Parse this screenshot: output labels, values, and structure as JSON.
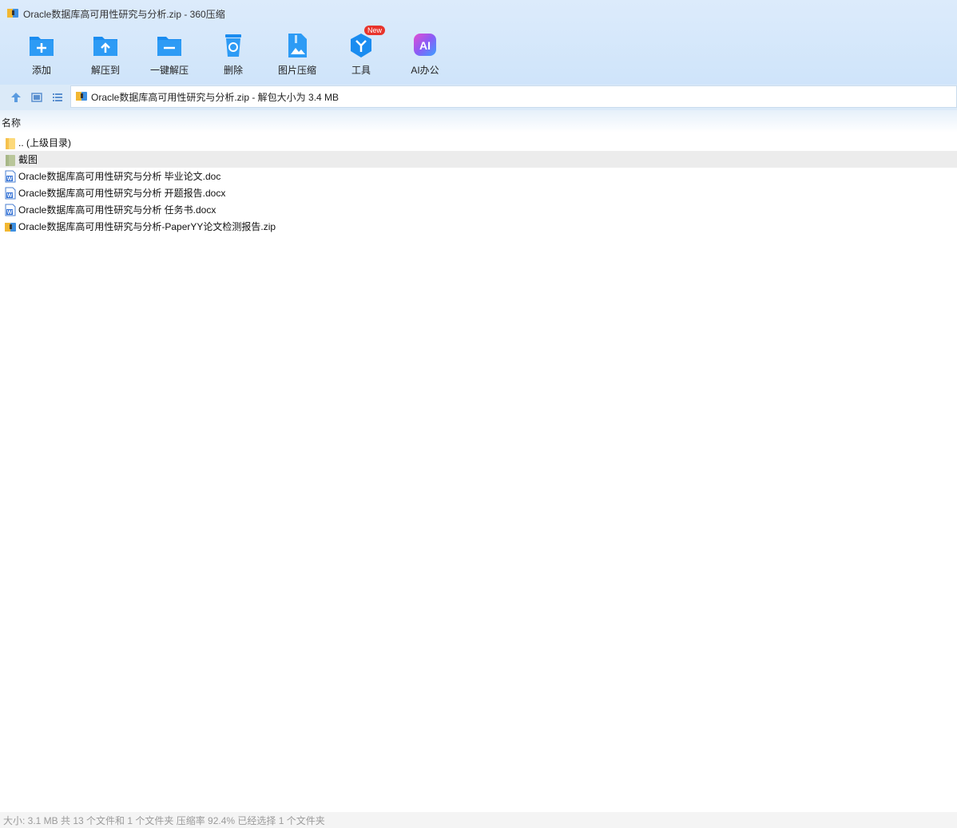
{
  "window": {
    "title": "Oracle数据库高可用性研究与分析.zip - 360压缩"
  },
  "toolbar": {
    "items": [
      {
        "label": "添加",
        "icon": "add-folder-icon"
      },
      {
        "label": "解压到",
        "icon": "extract-to-icon"
      },
      {
        "label": "一键解压",
        "icon": "one-click-extract-icon"
      },
      {
        "label": "删除",
        "icon": "delete-icon"
      },
      {
        "label": "图片压缩",
        "icon": "image-compress-icon"
      },
      {
        "label": "工具",
        "icon": "tools-icon",
        "badge": "New"
      },
      {
        "label": "AI办公",
        "icon": "ai-office-icon"
      }
    ]
  },
  "address": {
    "path": "Oracle数据库高可用性研究与分析.zip - 解包大小为 3.4 MB"
  },
  "list": {
    "header": "名称",
    "rows": [
      {
        "name": ".. (上级目录)",
        "icon": "parent-folder-icon"
      },
      {
        "name": "截图",
        "icon": "folder-icon",
        "selected": true
      },
      {
        "name": "Oracle数据库高可用性研究与分析 毕业论文.doc",
        "icon": "word-doc-icon"
      },
      {
        "name": "Oracle数据库高可用性研究与分析 开题报告.docx",
        "icon": "word-docx-icon"
      },
      {
        "name": "Oracle数据库高可用性研究与分析 任务书.docx",
        "icon": "word-docx-icon"
      },
      {
        "name": "Oracle数据库高可用性研究与分析-PaperYY论文检测报告.zip",
        "icon": "zip-archive-icon"
      }
    ]
  },
  "status": {
    "text": "大小: 3.1 MB 共 13 个文件和 1 个文件夹 压缩率 92.4% 已经选择 1 个文件夹"
  },
  "colors": {
    "accent": "#1a8cf0",
    "ai": "#a84bf0",
    "badge": "#e8342c"
  }
}
